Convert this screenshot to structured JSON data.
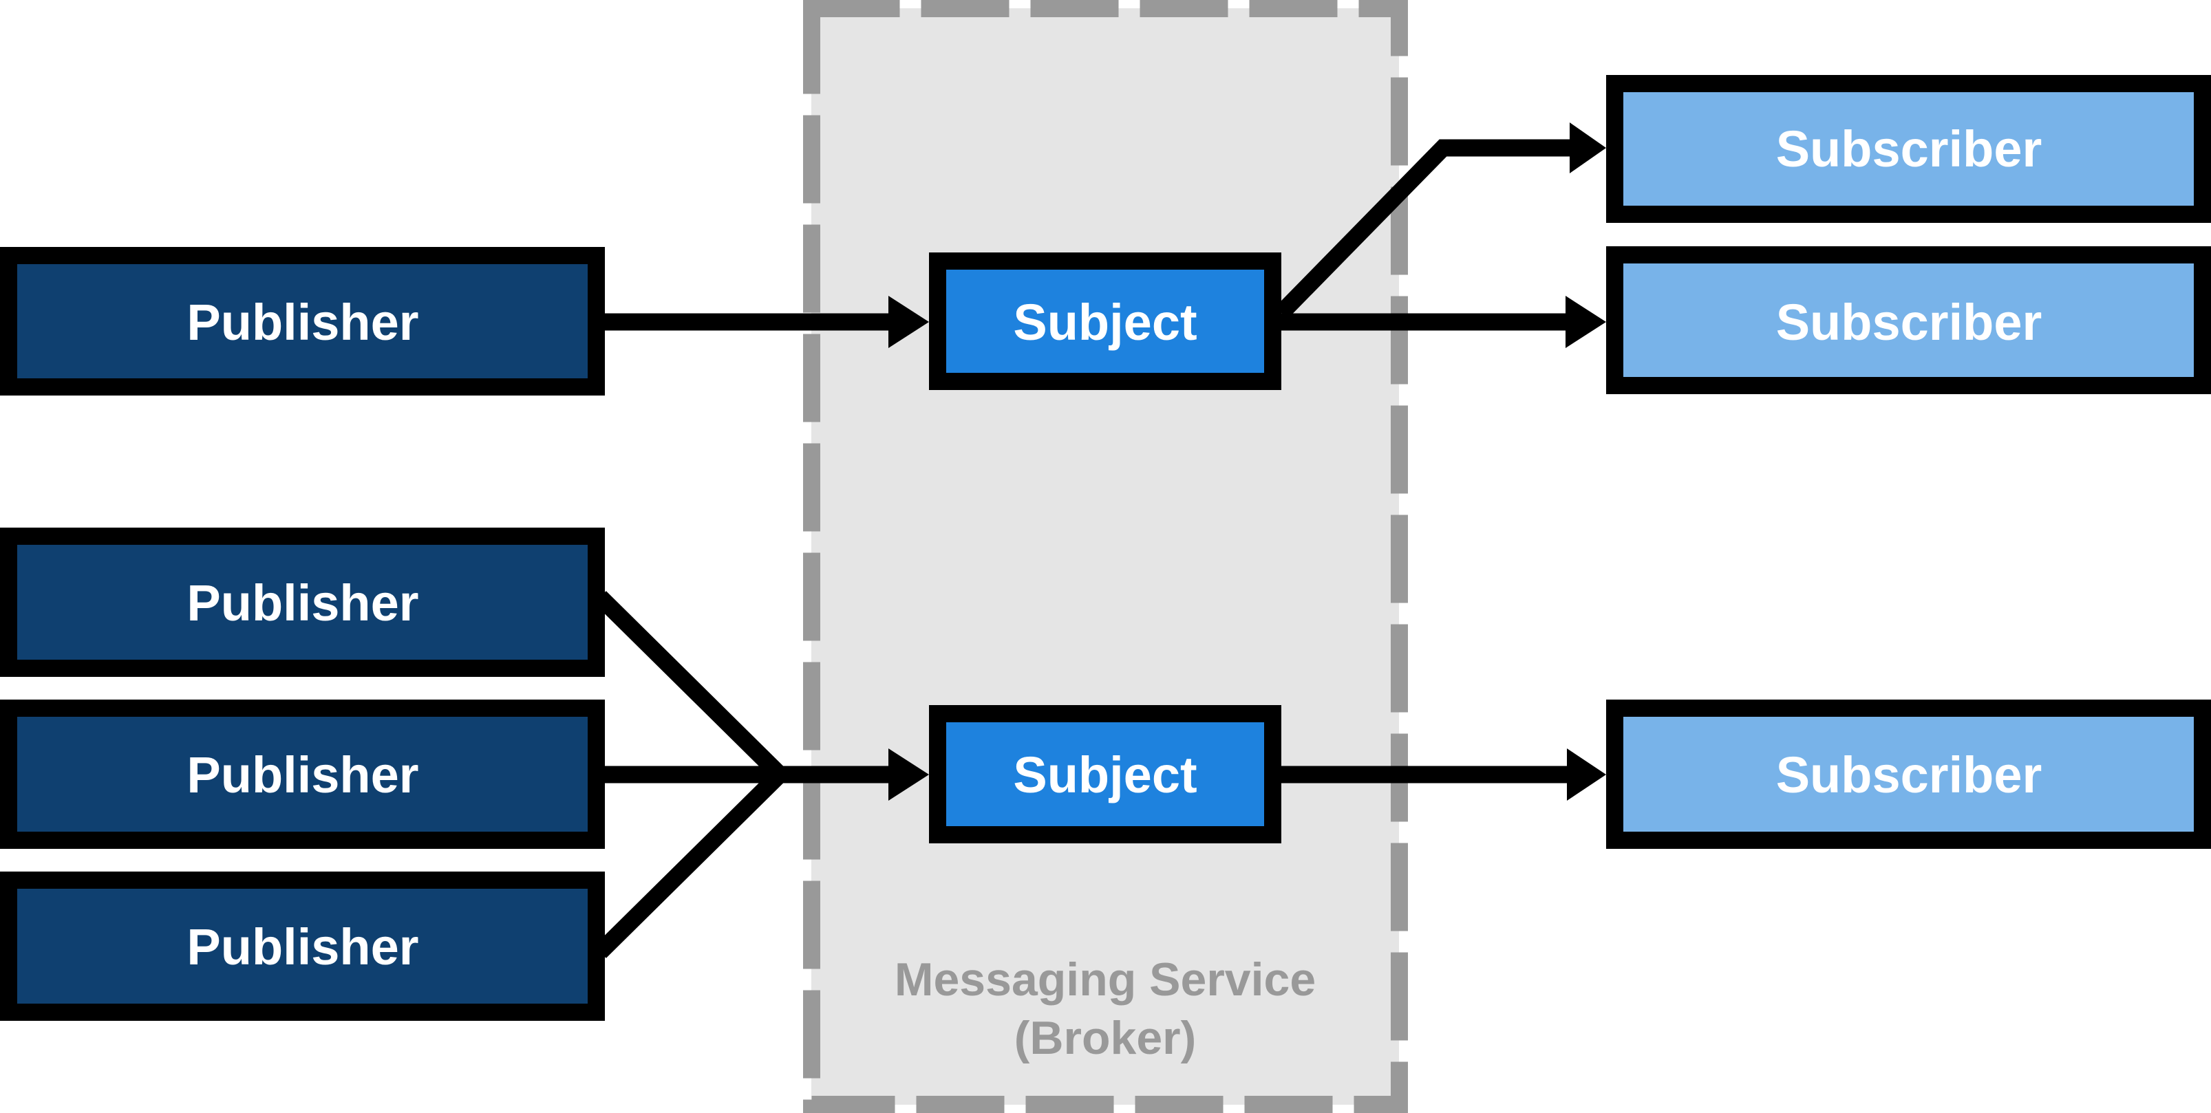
{
  "diagram": {
    "type": "publish-subscribe",
    "broker": {
      "label_line1": "Messaging Service",
      "label_line2": "(Broker)",
      "fill_color": "#E5E5E5",
      "border_color": "#999999",
      "border_style": "dashed"
    },
    "publishers": [
      {
        "id": "p1",
        "label": "Publisher"
      },
      {
        "id": "p2",
        "label": "Publisher"
      },
      {
        "id": "p3",
        "label": "Publisher"
      },
      {
        "id": "p4",
        "label": "Publisher"
      }
    ],
    "subjects": [
      {
        "id": "s1",
        "label": "Subject"
      },
      {
        "id": "s2",
        "label": "Subject"
      }
    ],
    "subscribers": [
      {
        "id": "c1",
        "label": "Subscriber"
      },
      {
        "id": "c2",
        "label": "Subscriber"
      },
      {
        "id": "c3",
        "label": "Subscriber"
      }
    ],
    "edges": [
      {
        "from": "p1",
        "to": "s1"
      },
      {
        "from": "p2",
        "to": "s2"
      },
      {
        "from": "p3",
        "to": "s2"
      },
      {
        "from": "p4",
        "to": "s2"
      },
      {
        "from": "s1",
        "to": "c1"
      },
      {
        "from": "s1",
        "to": "c2"
      },
      {
        "from": "s2",
        "to": "c3"
      }
    ],
    "colors": {
      "publisher_fill": "#0F4070",
      "subject_fill": "#1E82DE",
      "subscriber_fill": "#78B3E9",
      "node_border": "#000000",
      "label_text": "#FFFFFF",
      "arrow": "#000000"
    }
  }
}
